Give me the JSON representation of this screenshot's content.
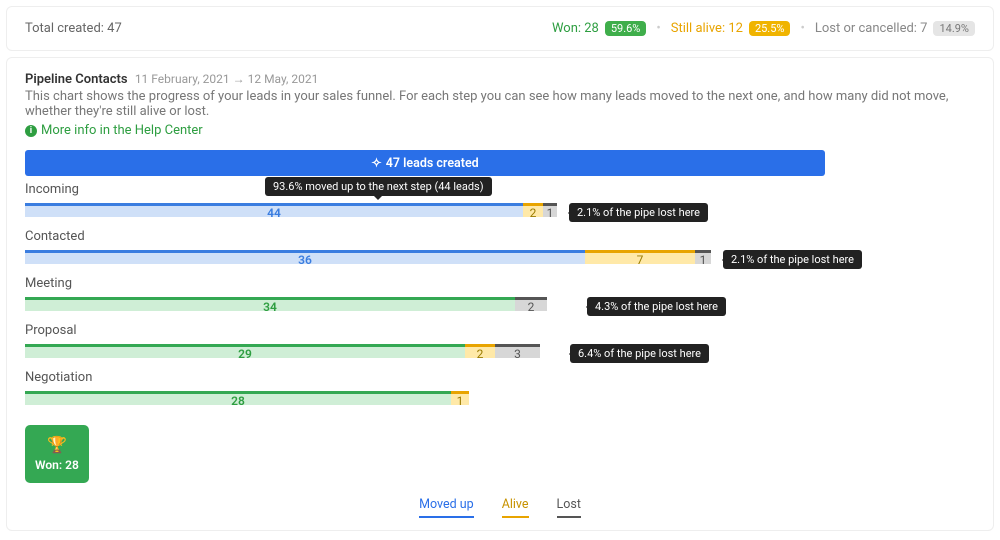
{
  "summary": {
    "total_label": "Total created:",
    "total_value": "47",
    "won_label": "Won: 28",
    "won_pct": "59.6%",
    "alive_label": "Still alive: 12",
    "alive_pct": "25.5%",
    "lost_label": "Lost or cancelled: 7",
    "lost_pct": "14.9%"
  },
  "header": {
    "title": "Pipeline Contacts",
    "date_from": "11 February, 2021",
    "arrow": "→",
    "date_to": "12 May, 2021",
    "desc": "This chart shows the progress of your leads in your sales funnel. For each step you can see how many leads moved to the next one, and how many did not move, whether they're still alive or lost.",
    "help_link": "More info in the Help Center"
  },
  "created_bar": "47 leads created",
  "stages": {
    "incoming": {
      "label": "Incoming",
      "moved": "44",
      "alive": "2",
      "lost": "1",
      "lost_tip": "2.1% of the pipe lost here",
      "hover_tip": "93.6% moved up to the next step (44 leads)"
    },
    "contacted": {
      "label": "Contacted",
      "moved": "36",
      "alive": "7",
      "lost": "1",
      "lost_tip": "2.1% of the pipe lost here"
    },
    "meeting": {
      "label": "Meeting",
      "moved": "34",
      "lost": "2",
      "lost_tip": "4.3% of the pipe lost here"
    },
    "proposal": {
      "label": "Proposal",
      "moved": "29",
      "alive": "2",
      "lost": "3",
      "lost_tip": "6.4% of the pipe lost here"
    },
    "negotiation": {
      "label": "Negotiation",
      "moved": "28",
      "alive": "1"
    }
  },
  "won_badge": "Won: 28",
  "legend": {
    "moved": "Moved up",
    "alive": "Alive",
    "lost": "Lost"
  },
  "chart_data": {
    "type": "bar",
    "title": "Pipeline Contacts — sales-funnel progress",
    "total_created": 47,
    "stages": [
      {
        "name": "Incoming",
        "moved_up": 44,
        "alive": 2,
        "lost": 1,
        "pipe_lost_pct": 2.1,
        "moved_up_pct": 93.6
      },
      {
        "name": "Contacted",
        "moved_up": 36,
        "alive": 7,
        "lost": 1,
        "pipe_lost_pct": 2.1
      },
      {
        "name": "Meeting",
        "moved_up": 34,
        "alive": 0,
        "lost": 2,
        "pipe_lost_pct": 4.3
      },
      {
        "name": "Proposal",
        "moved_up": 29,
        "alive": 2,
        "lost": 3,
        "pipe_lost_pct": 6.4
      },
      {
        "name": "Negotiation",
        "moved_up": 28,
        "alive": 1,
        "lost": 0
      }
    ],
    "won": 28,
    "series_legend": [
      "Moved up",
      "Alive",
      "Lost"
    ],
    "xlim": [
      0,
      47
    ]
  }
}
